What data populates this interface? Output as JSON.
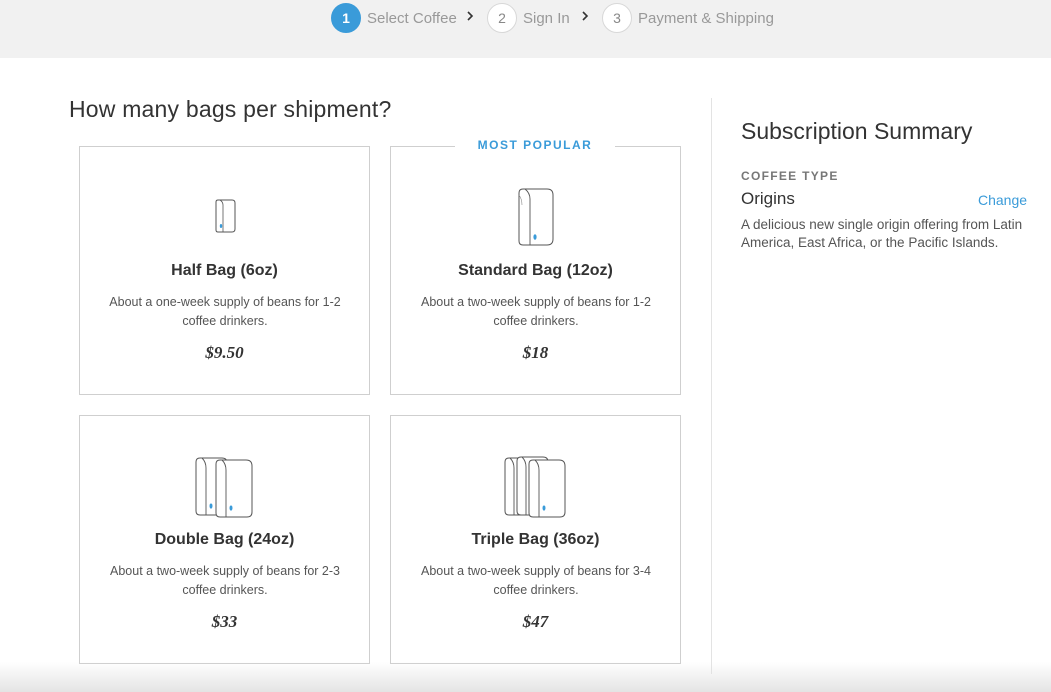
{
  "stepper": {
    "steps": [
      {
        "number": "1",
        "label": "Select Coffee",
        "active": true
      },
      {
        "number": "2",
        "label": "Sign In",
        "active": false
      },
      {
        "number": "3",
        "label": "Payment & Shipping",
        "active": false
      }
    ]
  },
  "main": {
    "title": "How many bags per shipment?",
    "popular_label": "MOST POPULAR",
    "options": [
      {
        "name": "Half Bag (6oz)",
        "description": "About a one-week supply of beans for 1-2 coffee drinkers.",
        "price": "$9.50",
        "icon": "half-bag-icon"
      },
      {
        "name": "Standard Bag (12oz)",
        "description": "About a two-week supply of beans for 1-2 coffee drinkers.",
        "price": "$18",
        "icon": "standard-bag-icon"
      },
      {
        "name": "Double Bag (24oz)",
        "description": "About a two-week supply of beans for 2-3 coffee drinkers.",
        "price": "$33",
        "icon": "double-bag-icon"
      },
      {
        "name": "Triple Bag (36oz)",
        "description": "About a two-week supply of beans for 3-4 coffee drinkers.",
        "price": "$47",
        "icon": "triple-bag-icon"
      }
    ]
  },
  "summary": {
    "title": "Subscription Summary",
    "section_label": "COFFEE TYPE",
    "coffee_type": "Origins",
    "change_label": "Change",
    "description": "A delicious new single origin offering from Latin America, East Africa, or the Pacific Islands."
  },
  "colors": {
    "accent": "#3a9bd9",
    "stepper_bg": "#f1f1f1",
    "card_border": "#cfcfcf"
  }
}
